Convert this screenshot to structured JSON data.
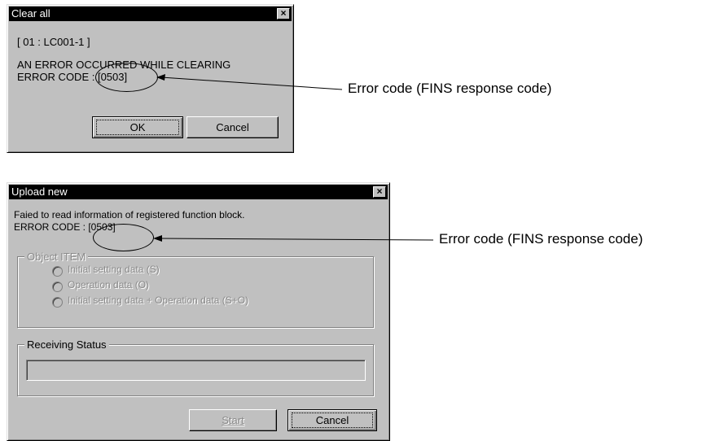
{
  "dialog1": {
    "title": "Clear all",
    "unit_line": "[ 01 : LC001-1 ]",
    "message_line1": "AN ERROR OCCURRED WHILE CLEARING",
    "message_line2": "ERROR CODE : [0503]",
    "ok_label": "OK",
    "cancel_label": "Cancel",
    "annotation": "Error code (FINS response code)"
  },
  "dialog2": {
    "title": "Upload new",
    "message_line1": "Faied to read information of registered function block.",
    "message_line2": "ERROR CODE : [0503]",
    "object_group_label": "Object ITEM",
    "options": [
      "Initial setting data (S)",
      "Operation data (O)",
      "Initial setting data + Operation data (S+O)"
    ],
    "receiving_status_label": "Receiving Status",
    "start_label": "Start",
    "cancel_label": "Cancel",
    "annotation": "Error code (FINS response code)"
  }
}
